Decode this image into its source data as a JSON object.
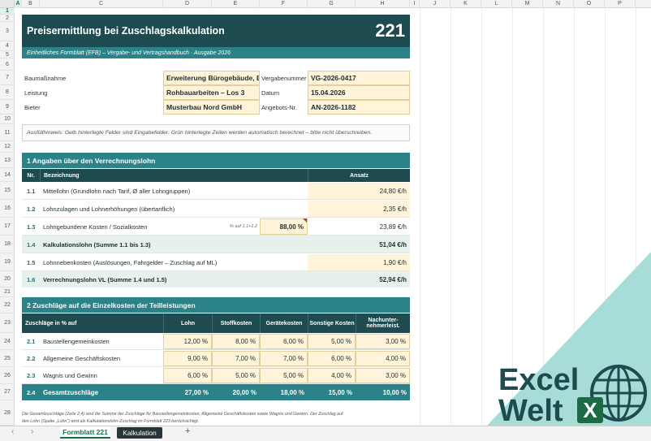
{
  "columns": [
    "A",
    "B",
    "C",
    "D",
    "E",
    "F",
    "G",
    "H",
    "I",
    "J",
    "K",
    "L",
    "M",
    "N",
    "O",
    "P"
  ],
  "rows": [
    "1",
    "2",
    "3",
    "4",
    "5",
    "6",
    "7",
    "8",
    "9",
    "10",
    "11",
    "12",
    "13",
    "14",
    "15",
    "16",
    "17",
    "18",
    "19",
    "20",
    "21",
    "22",
    "23",
    "24",
    "25",
    "26",
    "27",
    "28"
  ],
  "header": {
    "title": "Preisermittlung bei Zuschlagskalkulation",
    "form_number": "221",
    "subtitle": "Einheitliches Formblatt (EFB) – Vergabe- und Vertragshandbuch · Ausgabe 2026"
  },
  "meta": {
    "baumassnahme_label": "Baumaßnahme",
    "baumassnahme_value": "Erweiterung Bürogebäude, Ba",
    "leistung_label": "Leistung",
    "leistung_value": "Rohbauarbeiten – Los 3",
    "bieter_label": "Bieter",
    "bieter_value": "Musterbau Nord GmbH",
    "vergabenummer_label": "Vergabenummer",
    "vergabenummer_value": "VG-2026-0417",
    "datum_label": "Datum",
    "datum_value": "15.04.2026",
    "angebots_label": "Angebots-Nr.",
    "angebots_value": "AN-2026-1182"
  },
  "hint": "Ausfüllhinweis: Gelb hinterlegte Felder sind Eingabefelder. Grün hinterlegte Zeilen werden automatisch berechnet – bitte nicht überschreiben.",
  "section1": {
    "title": "1 Angaben über den Verrechnungslohn",
    "col_nr": "Nr.",
    "col_bez": "Bezeichnung",
    "col_ansatz": "Ansatz",
    "rows": [
      {
        "nr": "1.1",
        "label": "Mittellohn (Grundlohn nach Tarif, Ø aller Lohngruppen)",
        "value": "24,80 €/h"
      },
      {
        "nr": "1.2",
        "label": "Lohnzulagen und Lohnerhöhungen (übertariflich)",
        "value": "2,35 €/h"
      },
      {
        "nr": "1.3",
        "label": "Lohngebundene Kosten / Sozialkosten",
        "note": "% auf 1.1+1.2",
        "pct": "88,00 %",
        "value": "23,89 €/h"
      },
      {
        "nr": "1.4",
        "label": "Kalkulationslohn (Summe 1.1 bis 1.3)",
        "value": "51,04 €/h"
      },
      {
        "nr": "1.5",
        "label": "Lohnnebenkosten (Auslösungen, Fahrgelder – Zuschlag auf ML)",
        "value": "1,90 €/h"
      },
      {
        "nr": "1.6",
        "label": "Verrechnungslohn VL (Summe 1.4 und 1.5)",
        "value": "52,94 €/h"
      }
    ]
  },
  "section2": {
    "title": "2 Zuschläge auf die Einzelkosten der Teilleistungen",
    "col_label": "Zuschläge in % auf",
    "cols": [
      "Lohn",
      "Stoffkosten",
      "Gerätekosten",
      "Sonstige Kosten",
      "Nachunter-nehmerleist."
    ],
    "rows": [
      {
        "nr": "2.1",
        "label": "Baustellengemeinkosten",
        "values": [
          "12,00 %",
          "8,00 %",
          "6,00 %",
          "5,00 %",
          "3,00 %"
        ]
      },
      {
        "nr": "2.2",
        "label": "Allgemeine Geschäftskosten",
        "values": [
          "9,00 %",
          "7,00 %",
          "7,00 %",
          "6,00 %",
          "4,00 %"
        ]
      },
      {
        "nr": "2.3",
        "label": "Wagnis und Gewinn",
        "values": [
          "6,00 %",
          "5,00 %",
          "5,00 %",
          "4,00 %",
          "3,00 %"
        ]
      },
      {
        "nr": "2.4",
        "label": "Gesamtzuschläge",
        "values": [
          "27,00 %",
          "20,00 %",
          "18,00 %",
          "15,00 %",
          "10,00 %"
        ]
      }
    ],
    "footnote1": "Die Gesamtzuschläge (Zeile 2.4) sind die Summe der Zuschläge für Baustellengemeinkosten, Allgemeine Geschäftskosten sowie Wagnis und Gewinn. Der Zuschlag auf",
    "footnote2": "den Lohn (Spalte „Lohn“) wird als Kalkulationslohn-Zuschlag im Formblatt 223 berücksichtigt."
  },
  "tabs": {
    "sheet1": "Formblatt 221",
    "sheet2": "Kalkulation",
    "add": "+"
  },
  "logo": {
    "line1": "Excel",
    "line2": "Welt",
    "letter": "X"
  },
  "colors": {
    "dark_teal": "#1d4b50",
    "teal": "#2b8288",
    "input": "#fff4d9",
    "sum": "#e6f1ec"
  }
}
